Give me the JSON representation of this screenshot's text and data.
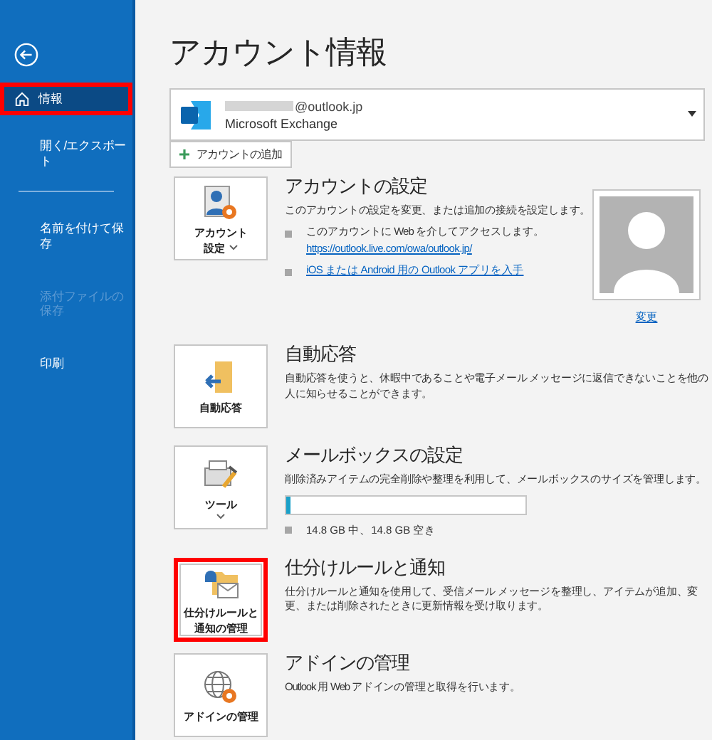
{
  "sidebar": {
    "items": [
      {
        "label": "情報",
        "kind": "home",
        "selected": true,
        "disabled": false,
        "highlighted": true,
        "divider_after": false
      },
      {
        "label": "開く/エクスポート",
        "kind": "plain",
        "selected": false,
        "disabled": false,
        "highlighted": false,
        "divider_after": true
      },
      {
        "label": "名前を付けて保存",
        "kind": "plain",
        "selected": false,
        "disabled": false,
        "highlighted": false,
        "divider_after": false
      },
      {
        "label": "添付ファイルの保存",
        "kind": "plain",
        "selected": false,
        "disabled": true,
        "highlighted": false,
        "divider_after": false
      },
      {
        "label": "印刷",
        "kind": "plain",
        "selected": false,
        "disabled": false,
        "highlighted": false,
        "divider_after": false
      }
    ]
  },
  "title": "アカウント情報",
  "account": {
    "email": "@outlook.jp",
    "type": "Microsoft Exchange"
  },
  "add_account": {
    "label": "アカウントの追加"
  },
  "sections": [
    {
      "kind": "account",
      "button_lines": [
        "アカウント",
        "設定"
      ],
      "has_menu": true,
      "highlighted": false,
      "heading": "アカウントの設定",
      "description": "このアカウントの設定を変更、または追加の接続を設定します。",
      "bullets": [
        {
          "text": "このアカウントに Web を介してアクセスします。",
          "link": "https://outlook.live.com/owa/outlook.jp/"
        },
        {
          "link": "iOS または Android 用の Outlook アプリを入手"
        }
      ],
      "photo": {
        "link": "変更"
      }
    },
    {
      "kind": "autoreply",
      "button_lines": [
        "自動応答"
      ],
      "has_menu": false,
      "highlighted": false,
      "heading": "自動応答",
      "description": "自動応答を使うと、休暇中であることや電子メール メッセージに返信できないことを他の人に知らせることができます。"
    },
    {
      "kind": "tools",
      "button_lines": [
        "ツール"
      ],
      "has_menu": true,
      "highlighted": false,
      "heading": "メールボックスの設定",
      "description": "削除済みアイテムの完全削除や整理を利用して、メールボックスのサイズを管理します。",
      "level": 0.02,
      "usage": "14.8 GB 中、14.8 GB 空き"
    },
    {
      "kind": "rules",
      "button_lines": [
        "仕分けルールと",
        "通知の管理"
      ],
      "has_menu": false,
      "highlighted": true,
      "heading": "仕分けルールと通知",
      "description": "仕分けルールと通知を使用して、受信メール メッセージを整理し、アイテムが追加、変更、または削除されたときに更新情報を受け取ります。"
    },
    {
      "kind": "addins",
      "button_lines": [
        "アドインの管理"
      ],
      "has_menu": false,
      "highlighted": false,
      "heading": "アドインの管理",
      "description": "Outlook 用 Web アドインの管理と取得を行います。"
    }
  ]
}
